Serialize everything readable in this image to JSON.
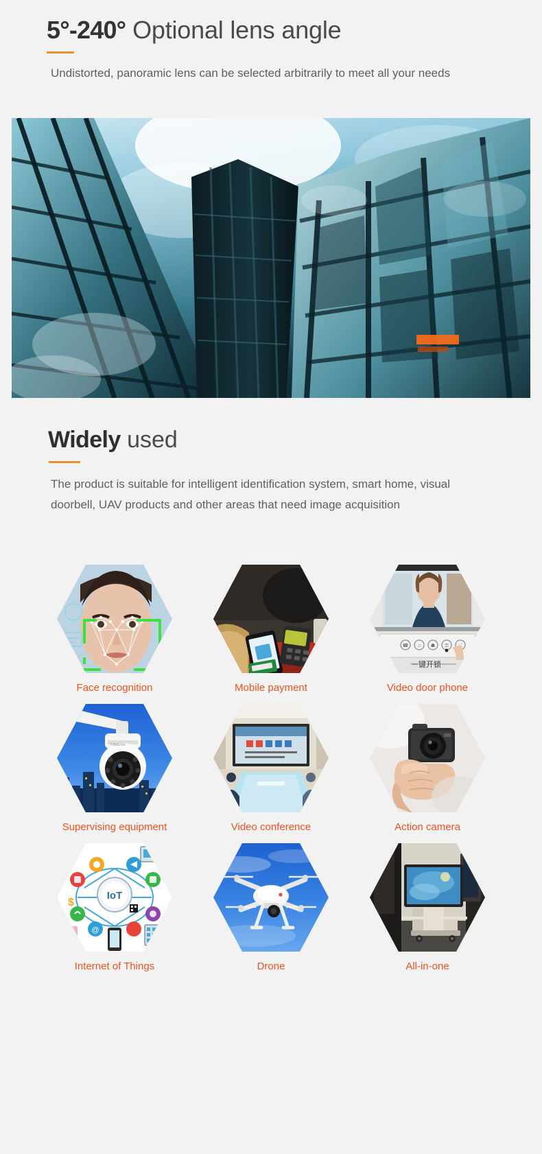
{
  "theme": {
    "page_bg": "#f2f2f2",
    "accent_rule": "#e8922e",
    "label_orange": "#f4511e",
    "heading_dark": "#2e2e2e",
    "body_gray": "#5f5f5f"
  },
  "section_lens": {
    "headline_strong": "5°-240°",
    "headline_rest": " Optional lens angle",
    "subtext": "Undistorted, panoramic lens can be selected arbitrarily to meet all your needs",
    "hero_alt": "glass-skyscraper-upward-view"
  },
  "section_usage": {
    "headline_strong": "Widely",
    "headline_rest": " used",
    "subtext": "The product is suitable for intelligent identification system, smart home, visual doorbell, UAV products and other areas that need image acquisition",
    "rows": [
      [
        {
          "label": "Face recognition",
          "icon": "face-recognition-photo",
          "overlay": ""
        },
        {
          "label": "Mobile payment",
          "icon": "mobile-payment-photo",
          "overlay": ""
        },
        {
          "label": "Video door phone",
          "icon": "video-door-phone-photo",
          "overlay": "一键开锁"
        }
      ],
      [
        {
          "label": "Supervising equipment",
          "icon": "ptz-camera-photo",
          "overlay": ""
        },
        {
          "label": "Video conference",
          "icon": "video-conference-photo",
          "overlay": ""
        },
        {
          "label": "Action camera",
          "icon": "action-camera-photo",
          "overlay": ""
        }
      ],
      [
        {
          "label": "Internet of Things",
          "icon": "internet-of-things-photo",
          "overlay": "IoT"
        },
        {
          "label": "Drone",
          "icon": "drone-photo",
          "overlay": ""
        },
        {
          "label": "All-in-one",
          "icon": "all-in-one-kiosk-photo",
          "overlay": ""
        }
      ]
    ]
  }
}
